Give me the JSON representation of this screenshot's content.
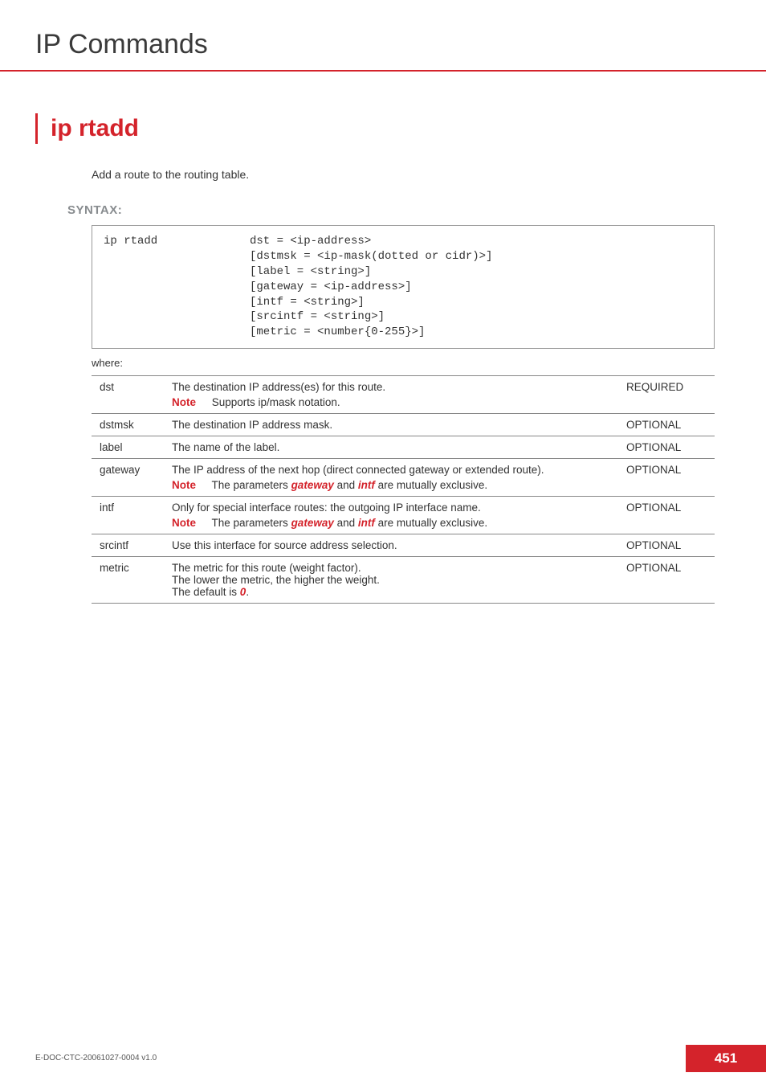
{
  "chapter_title": "IP Commands",
  "section_title": "ip rtadd",
  "section_intro": "Add a route to the routing table.",
  "subhead_syntax": "SYNTAX:",
  "syntax": {
    "command": "ip rtadd",
    "args": [
      "dst = <ip-address>",
      "[dstmsk = <ip-mask(dotted or cidr)>]",
      "[label = <string>]",
      "[gateway = <ip-address>]",
      "[intf = <string>]",
      "[srcintf = <string>]",
      "[metric = <number{0-255}>]"
    ]
  },
  "where_label": "where:",
  "note_label": "Note",
  "params": [
    {
      "name": "dst",
      "desc": "The destination IP address(es) for this route.",
      "note_text": "Supports ip/mask notation.",
      "req": "REQUIRED"
    },
    {
      "name": "dstmsk",
      "desc": "The destination IP address mask.",
      "req": "OPTIONAL"
    },
    {
      "name": "label",
      "desc": "The name of the label.",
      "req": "OPTIONAL"
    },
    {
      "name": "gateway",
      "desc": "The IP address of the next hop (direct connected gateway or extended route).",
      "note_parts": {
        "pre": "The parameters ",
        "em1": "gateway",
        "mid": " and ",
        "em2": "intf",
        "post": " are mutually exclusive."
      },
      "req": "OPTIONAL"
    },
    {
      "name": "intf",
      "desc": "Only for special interface routes: the outgoing IP interface name.",
      "note_parts": {
        "pre": "The parameters ",
        "em1": "gateway",
        "mid": " and ",
        "em2": "intf",
        "post": " are mutually exclusive."
      },
      "req": "OPTIONAL"
    },
    {
      "name": "srcintf",
      "desc": "Use this interface for source address selection.",
      "req": "OPTIONAL"
    },
    {
      "name": "metric",
      "desc_lines": [
        "The metric for this route (weight factor).",
        "The lower the metric, the higher the weight."
      ],
      "default_pre": "The default is ",
      "default_val": "0",
      "default_post": ".",
      "req": "OPTIONAL"
    }
  ],
  "footer_doc": "E-DOC-CTC-20061027-0004 v1.0",
  "page_number": "451"
}
